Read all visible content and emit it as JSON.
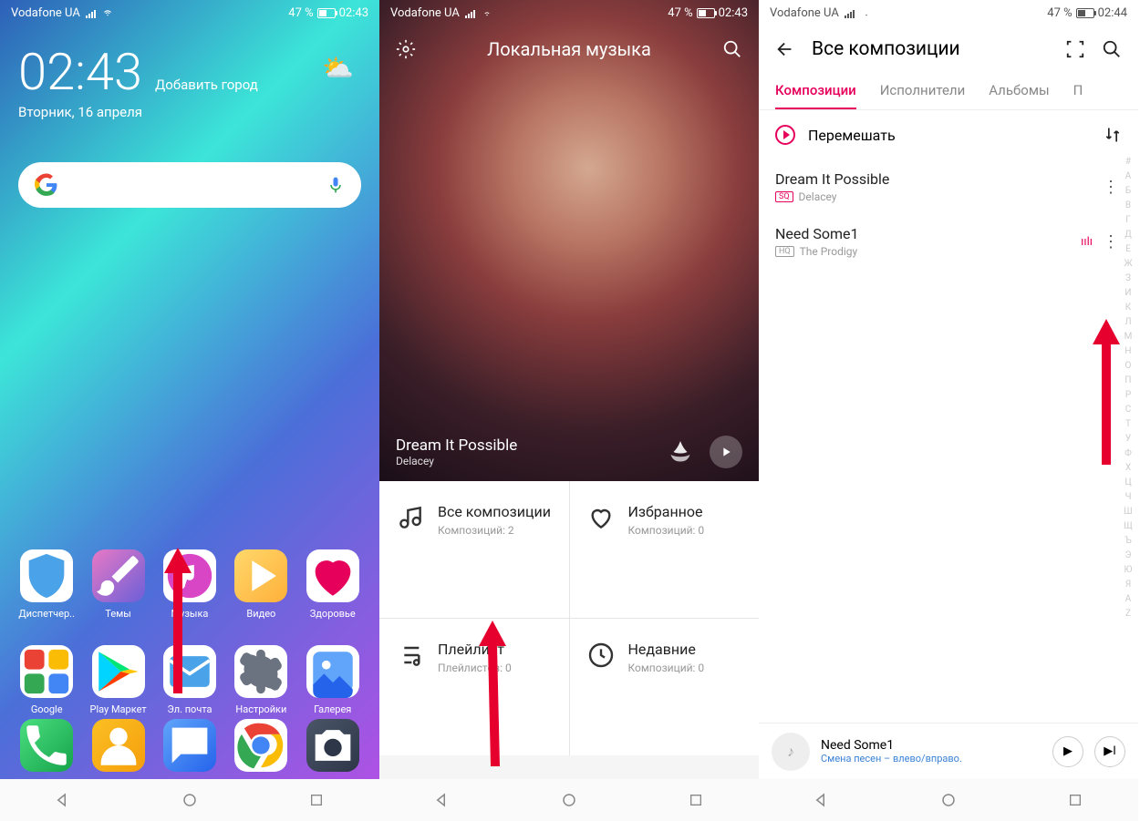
{
  "status": {
    "carrier": "Vodafone UA",
    "battery": "47 %",
    "time1": "02:43",
    "time3": "02:44"
  },
  "home": {
    "clock": "02:43",
    "add_city": "Добавить город",
    "date": "Вторник, 16 апреля",
    "row1": [
      {
        "label": "Диспетчер..",
        "bg": "#fff",
        "icon": "shield"
      },
      {
        "label": "Темы",
        "bg": "linear-gradient(135deg,#e879c5,#6b5fd8)",
        "icon": "brush"
      },
      {
        "label": "Музыка",
        "bg": "#fff",
        "icon": "music"
      },
      {
        "label": "Видео",
        "bg": "linear-gradient(135deg,#ffd86b,#ffb03a)",
        "icon": "play"
      },
      {
        "label": "Здоровье",
        "bg": "#fff",
        "icon": "heart"
      }
    ],
    "row2": [
      {
        "label": "Google",
        "bg": "#fff",
        "icon": "folder"
      },
      {
        "label": "Play Маркет",
        "bg": "#fff",
        "icon": "playstore"
      },
      {
        "label": "Эл. почта",
        "bg": "#fff",
        "icon": "mail"
      },
      {
        "label": "Настройки",
        "bg": "#fff",
        "icon": "gear"
      },
      {
        "label": "Галерея",
        "bg": "#fff",
        "icon": "gallery"
      }
    ],
    "dock": [
      {
        "bg": "linear-gradient(135deg,#4ade80,#16a34a)",
        "icon": "phone"
      },
      {
        "bg": "linear-gradient(135deg,#fbbf24,#f59e0b)",
        "icon": "contacts"
      },
      {
        "bg": "linear-gradient(135deg,#60a5fa,#2563eb)",
        "icon": "msg"
      },
      {
        "bg": "#fff",
        "icon": "chrome"
      },
      {
        "bg": "linear-gradient(135deg,#4a5568,#2d3748)",
        "icon": "camera"
      }
    ]
  },
  "music": {
    "header_title": "Локальная музыка",
    "now_playing": {
      "track": "Dream It Possible",
      "artist": "Delacey"
    },
    "cards": [
      {
        "title": "Все композиции",
        "sub": "Композиций: 2",
        "icon": "note"
      },
      {
        "title": "Избранное",
        "sub": "Композиций: 0",
        "icon": "heart"
      },
      {
        "title": "Плейлист",
        "sub": "Плейлистов: 0",
        "icon": "playlist"
      },
      {
        "title": "Недавние",
        "sub": "Композиций: 0",
        "icon": "clock"
      }
    ]
  },
  "tracks": {
    "header": "Все композиции",
    "tabs": [
      "Композиции",
      "Исполнители",
      "Альбомы",
      "П"
    ],
    "shuffle": "Перемешать",
    "items": [
      {
        "title": "Dream It Possible",
        "artist": "Delacey",
        "badge": "SQ"
      },
      {
        "title": "Need Some1",
        "artist": "The Prodigy",
        "badge": "HQ",
        "playing": true
      }
    ],
    "index": "#АБВГДЕЖЗИКЛМНОПРСТУФХЦЧШЩЪЭЮЯAZ",
    "mini": {
      "title": "Need Some1",
      "sub": "Смена песен – влево/вправо."
    }
  }
}
